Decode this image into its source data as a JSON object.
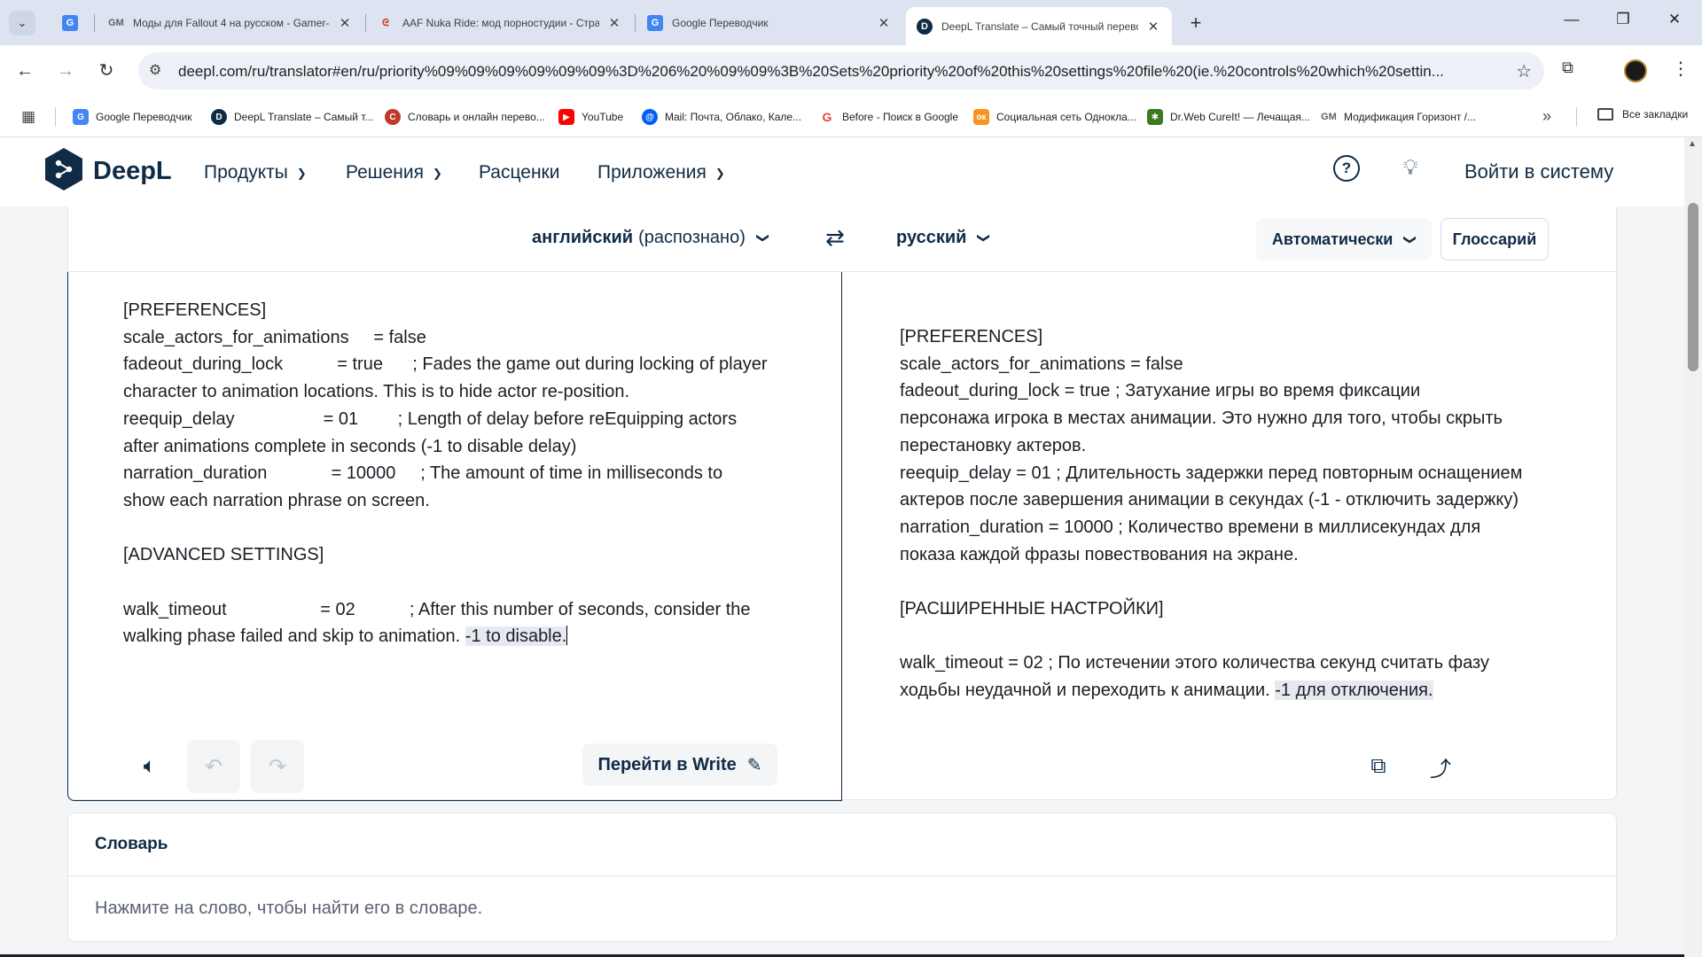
{
  "browser": {
    "tabs": [
      {
        "title": "",
        "favicon": "google-translate-icon",
        "color": "#4285f4"
      },
      {
        "title": "Моды для Fallout 4 на русском - Gamer-",
        "favicon": "gm-icon",
        "color": "#5f6368"
      },
      {
        "title": "AAF Nuka Ride: мод порностудии - Стра",
        "favicon": "swirl-icon",
        "color": "#d93025"
      },
      {
        "title": "Google Переводчик",
        "favicon": "google-translate-icon",
        "color": "#4285f4"
      },
      {
        "title": "DeepL Translate – Самый точный перево",
        "favicon": "deepl-icon",
        "color": "#0f2b46",
        "active": true
      }
    ],
    "url": "deepl.com/ru/translator#en/ru/priority%09%09%09%09%09%09%3D%206%20%09%09%3B%20Sets%20priority%20of%20this%20settings%20file%20(ie.%20controls%20which%20settin...",
    "bookmarks": [
      {
        "label": "Google Переводчик",
        "icon": "google-translate-icon",
        "color": "#4285f4"
      },
      {
        "label": "DeepL Translate – Самый т...",
        "icon": "deepl-icon",
        "color": "#0f2b46"
      },
      {
        "label": "Словарь и онлайн перево...",
        "icon": "dictionary-icon",
        "color": "#c0392b"
      },
      {
        "label": "YouTube",
        "icon": "youtube-icon",
        "color": "#ff0000"
      },
      {
        "label": "Mail: Почта, Облако, Кале...",
        "icon": "mail-icon",
        "color": "#005ff9"
      },
      {
        "label": "Before - Поиск в Google",
        "icon": "google-icon",
        "color": "#ea4335"
      },
      {
        "label": "Социальная сеть Однокла...",
        "icon": "odnoklassniki-icon",
        "color": "#f7931e"
      },
      {
        "label": "Dr.Web CureIt! — Лечащая...",
        "icon": "drweb-icon",
        "color": "#3d7a1e"
      },
      {
        "label": "Модификация Горизонт /...",
        "icon": "gm-icon",
        "color": "#5f6368"
      }
    ],
    "all_bookmarks": "Все закладки"
  },
  "header": {
    "logo": "DeepL",
    "nav": [
      "Продукты",
      "Решения",
      "Расценки",
      "Приложения"
    ],
    "login": "Войти в систему"
  },
  "translator": {
    "source_lang": "английский",
    "source_detected": "(распознано)",
    "target_lang": "русский",
    "formality": "Автоматически",
    "glossary": "Глоссарий",
    "source_lines": [
      "[PREFERENCES]",
      "scale_actors_for_animations     = false",
      "fadeout_during_lock           = true      ; Fades the game out during locking of player",
      "character to animation locations. This is to hide actor re-position.",
      "reequip_delay                  = 01        ; Length of delay before reEquipping actors",
      "after animations complete in seconds (-1 to disable delay)",
      "narration_duration             = 10000     ; The amount of time in milliseconds to",
      "show each narration phrase on screen.",
      "",
      "[ADVANCED SETTINGS]",
      "",
      "walk_timeout                   = 02           ; After this number of seconds, consider the"
    ],
    "source_last_plain": "walking phase failed and skip to animation. ",
    "source_last_highlight": "-1 to disable.",
    "target_lines": [
      "[PREFERENCES]",
      "scale_actors_for_animations = false",
      "fadeout_during_lock = true ; Затухание игры во время фиксации",
      "персонажа игрока в местах анимации. Это нужно для того, чтобы скрыть",
      "перестановку актеров.",
      "reequip_delay = 01 ; Длительность задержки перед повторным оснащением",
      "актеров после завершения анимации в секундах (-1 - отключить задержку)",
      "narration_duration = 10000 ; Количество времени в миллисекундах для",
      "показа каждой фразы повествования на экране.",
      "",
      "[РАСШИРЕННЫЕ НАСТРОЙКИ]",
      "",
      "walk_timeout = 02 ; По истечении этого количества секунд считать фазу"
    ],
    "target_last_plain": "ходьбы неудачной и переходить к анимации. ",
    "target_last_highlight": "-1 для отключения.",
    "write_button": "Перейти в Write"
  },
  "dictionary": {
    "title": "Словарь",
    "hint": "Нажмите на слово, чтобы найти его в словаре."
  }
}
